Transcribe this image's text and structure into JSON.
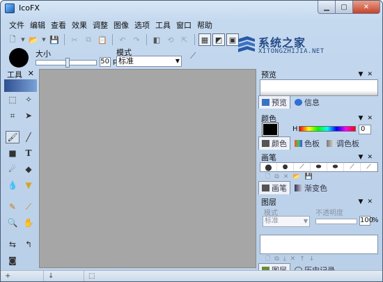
{
  "window": {
    "title": "IcoFX"
  },
  "menu": [
    "文件",
    "编辑",
    "查看",
    "效果",
    "调整",
    "图像",
    "选项",
    "工具",
    "窗口",
    "帮助"
  ],
  "watermark": {
    "text": "系统之家",
    "sub": "XITONGZHIJIA.NET"
  },
  "options": {
    "size_label": "大小",
    "size_value": "50",
    "size_unit": "px",
    "mode_label": "模式",
    "mode_value": "标准"
  },
  "tools_panel": {
    "title": "工具",
    "close": "✕"
  },
  "preview_panel": {
    "title": "预览",
    "tab_preview": "预览",
    "tab_info": "信息"
  },
  "color_panel": {
    "title": "颜色",
    "hue_label": "H",
    "hue_value": "0",
    "tab_color": "颜色",
    "tab_palette": "色板",
    "tab_swatches": "调色板"
  },
  "brush_panel": {
    "title": "画笔",
    "tab_brush": "画笔",
    "tab_gradient": "渐变色"
  },
  "layer_panel": {
    "title": "图层",
    "mode_label": "模式",
    "opacity_label": "不透明度",
    "mode_value": "标准",
    "opacity_value": "100",
    "opacity_unit": "%",
    "tab_layers": "图层",
    "tab_history": "历史记录"
  },
  "status": {
    "cell1": "+",
    "cell2": "↓",
    "cell3": "⬚"
  },
  "colors": {
    "foreground": "#000000",
    "canvas": "#a6a6a6"
  }
}
